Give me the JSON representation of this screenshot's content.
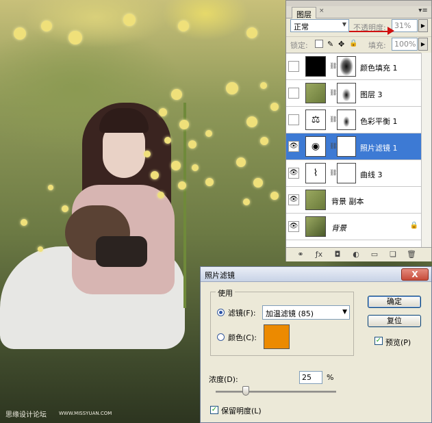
{
  "layers_panel": {
    "tab_label": "图层",
    "tab_close": "×",
    "menu_glyph": "▾≡",
    "blend_mode": "正常",
    "opacity_label": "不透明度:",
    "opacity_value": "31%",
    "lock_label": "锁定:",
    "fill_label": "填充:",
    "fill_value": "100%",
    "layers": [
      {
        "name": "颜色填充 1",
        "visible": false,
        "selected": false,
        "type": "color-fill",
        "has_mask": true
      },
      {
        "name": "图层 3",
        "visible": false,
        "selected": false,
        "type": "pixel",
        "has_mask": true
      },
      {
        "name": "色彩平衡 1",
        "visible": false,
        "selected": false,
        "type": "color-balance",
        "has_mask": true
      },
      {
        "name": "照片滤镜 1",
        "visible": true,
        "selected": true,
        "type": "photo-filter",
        "has_mask": true
      },
      {
        "name": "曲线 3",
        "visible": true,
        "selected": false,
        "type": "curves",
        "has_mask": true
      },
      {
        "name": "背景 副本",
        "visible": true,
        "selected": false,
        "type": "pixel",
        "has_mask": false
      },
      {
        "name": "背景",
        "visible": true,
        "selected": false,
        "type": "background",
        "has_mask": false,
        "locked": true
      }
    ],
    "toolbar_icons": [
      "link-icon",
      "fx-icon",
      "mask-icon",
      "adjustment-icon",
      "group-icon",
      "new-layer-icon",
      "trash-icon"
    ]
  },
  "dialog": {
    "title": "照片滤镜",
    "close_glyph": "X",
    "group_label": "使用",
    "filter_label": "滤镜(F):",
    "filter_value": "加温滤镜 (85)",
    "color_label": "颜色(C):",
    "color_swatch": "#ec8a00",
    "ok_label": "确定",
    "reset_label": "复位",
    "preview_label": "预览(P)",
    "preview_checked": true,
    "density_label": "浓度(D):",
    "density_value": "25",
    "density_unit": "%",
    "density_fraction": 0.25,
    "preserve_label": "保留明度(L)",
    "preserve_checked": true
  },
  "watermark": {
    "text": "思缘设计论坛",
    "url": "WWW.MISSYUAN.COM"
  },
  "colors": {
    "selection": "#3d7ad4",
    "arrow": "#d01010"
  }
}
